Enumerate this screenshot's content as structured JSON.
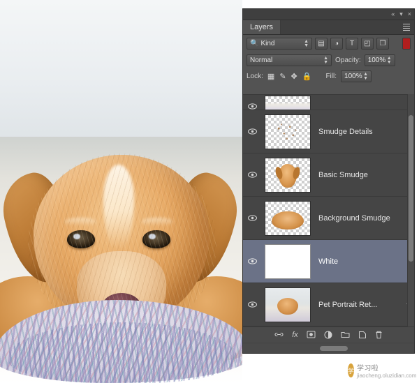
{
  "app": {
    "panel_title": "Layers",
    "titlebar": {
      "collapse_icon": "«",
      "minimize_icon": "▾",
      "close_icon": "×"
    },
    "menu_icon": "hamburger-menu-icon"
  },
  "filter_bar": {
    "kind_icon": "search-kind-icon",
    "kind_label": "Kind",
    "icons": [
      {
        "name": "filter-pixel-icon",
        "glyph": "▤"
      },
      {
        "name": "filter-adjustment-icon",
        "glyph": "◑"
      },
      {
        "name": "filter-type-icon",
        "glyph": "T"
      },
      {
        "name": "filter-shape-icon",
        "glyph": "◰"
      },
      {
        "name": "filter-smartobject-icon",
        "glyph": "❐"
      }
    ],
    "toggle_color": "#b01e1e"
  },
  "blend_bar": {
    "mode": "Normal",
    "opacity_label": "Opacity:",
    "opacity_value": "100%"
  },
  "lock_bar": {
    "lock_label": "Lock:",
    "lock_icons": [
      {
        "name": "lock-transparent-pixels-icon",
        "glyph": "▦"
      },
      {
        "name": "lock-image-pixels-icon",
        "glyph": "✎"
      },
      {
        "name": "lock-position-icon",
        "glyph": "✥"
      },
      {
        "name": "lock-all-icon",
        "glyph": "ὑ2"
      }
    ],
    "fill_label": "Fill:",
    "fill_value": "100%"
  },
  "layers": [
    {
      "name": "",
      "visible": true,
      "thumb": "partial",
      "selected": false,
      "partial": true
    },
    {
      "name": "Smudge Details",
      "visible": true,
      "thumb": "specks",
      "selected": false,
      "partial": false
    },
    {
      "name": "Basic Smudge",
      "visible": true,
      "thumb": "dog",
      "selected": false,
      "partial": false
    },
    {
      "name": "Background Smudge",
      "visible": true,
      "thumb": "wide",
      "selected": false,
      "partial": false
    },
    {
      "name": "White",
      "visible": true,
      "thumb": "white",
      "selected": true,
      "partial": false
    },
    {
      "name": "Pet Portrait Ret...",
      "visible": true,
      "thumb": "photo",
      "selected": false,
      "partial": false,
      "has_fx_arrow": true
    }
  ],
  "footer_icons": [
    {
      "name": "link-layers-icon",
      "glyph": "🔗"
    },
    {
      "name": "layer-style-fx-icon",
      "glyph": "fx"
    },
    {
      "name": "add-layer-mask-icon",
      "glyph": "▣"
    },
    {
      "name": "new-fill-adjustment-layer-icon",
      "glyph": "◑"
    },
    {
      "name": "new-group-icon",
      "glyph": "📁"
    },
    {
      "name": "new-layer-icon",
      "glyph": "❐"
    },
    {
      "name": "delete-layer-icon",
      "glyph": "🗑"
    }
  ],
  "watermark": {
    "badge": "学",
    "text": "学习啦",
    "sub": "jiaocheng.oluzidian.com"
  },
  "colors": {
    "panel_bg": "#535353",
    "list_bg": "#454545",
    "selected_row": "#6b7287",
    "filter_toggle": "#b01e1e"
  }
}
